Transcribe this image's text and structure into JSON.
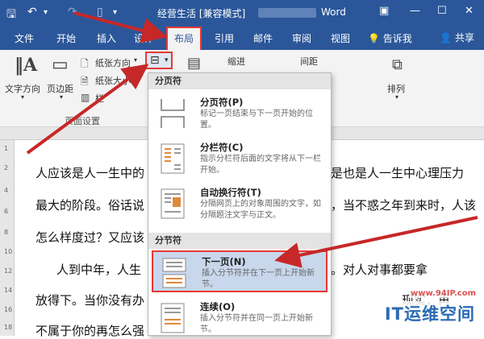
{
  "title_bar": {
    "doc_title": "经营生活 [兼容模式]",
    "title_suffix": "Word"
  },
  "tabs": [
    "文件",
    "开始",
    "插入",
    "设计",
    "布局",
    "引用",
    "邮件",
    "审阅",
    "视图"
  ],
  "active_tab": "布局",
  "tell_me": "告诉我",
  "share": "共享",
  "ribbon": {
    "text_direction": "文字方向",
    "margins": "页边距",
    "orientation": "纸张方向",
    "size": "纸张大小",
    "columns": "栏",
    "indent": "缩进",
    "spacing": "间距",
    "arrange": "排列",
    "group_label": "页面设置"
  },
  "menu": {
    "page_breaks_header": "分页符",
    "section_breaks_header": "分节符",
    "items": [
      {
        "title": "分页符(P)",
        "desc": "标记一页结束与下一页开始的位置。"
      },
      {
        "title": "分栏符(C)",
        "desc": "指示分栏符后面的文字将从下一栏开始。"
      },
      {
        "title": "自动换行符(T)",
        "desc": "分隔网页上的对象周围的文字，如分隔题注文字与正文。"
      },
      {
        "title": "下一页(N)",
        "desc": "插入分节符并在下一页上开始新节。"
      },
      {
        "title": "连续(O)",
        "desc": "插入分节符并在同一页上开始新节。"
      }
    ]
  },
  "document": {
    "lines": [
      {
        "left": "人应该是人一生中的",
        "right": "是也是人一生中心理压力"
      },
      {
        "left": "最大的阶段。俗话说",
        "right": "，当不惑之年到来时，人该"
      },
      {
        "left": "怎么样度过？又应该",
        "right": ""
      },
      {
        "left": "人到中年，人生",
        "right": "。对人对事都要拿"
      },
      {
        "left": "放得下。当你没有办",
        "right": "现实，再"
      },
      {
        "left": "不属于你的再怎么强",
        "right": ""
      }
    ]
  },
  "ruler_numbers": [
    "1",
    "2",
    "4",
    "6",
    "8",
    "10",
    "12",
    "14",
    "16",
    "18"
  ],
  "watermark": {
    "url": "www.94IP.com",
    "brand": "IT运维空间"
  },
  "colors": {
    "title_bar": "#2b579a",
    "highlight_border": "#e53935",
    "arrow": "#c62828",
    "selected_item": "#c8d7ec"
  }
}
